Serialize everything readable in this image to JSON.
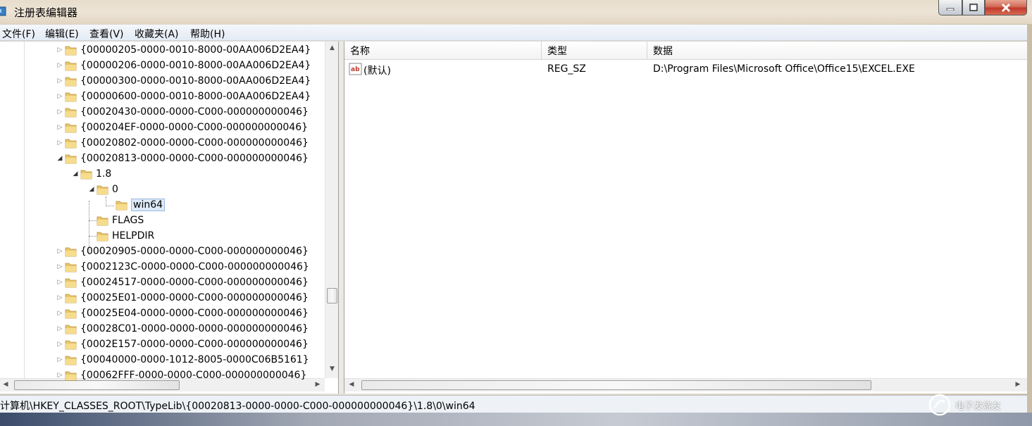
{
  "window": {
    "title": "注册表编辑器",
    "buttons": {
      "minimize": "minimize-icon",
      "maximize": "maximize-icon",
      "close": "close-icon"
    }
  },
  "menu": [
    "文件(F)",
    "编辑(E)",
    "查看(V)",
    "收藏夹(A)",
    "帮助(H)"
  ],
  "tree": {
    "nodes": [
      {
        "label": "{00000205-0000-0010-8000-00AA006D2EA4}",
        "expanded": false
      },
      {
        "label": "{00000206-0000-0010-8000-00AA006D2EA4}",
        "expanded": false
      },
      {
        "label": "{00000300-0000-0010-8000-00AA006D2EA4}",
        "expanded": false
      },
      {
        "label": "{00000600-0000-0010-8000-00AA006D2EA4}",
        "expanded": false
      },
      {
        "label": "{00020430-0000-0000-C000-000000000046}",
        "expanded": false
      },
      {
        "label": "{000204EF-0000-0000-C000-000000000046}",
        "expanded": false
      },
      {
        "label": "{00020802-0000-0000-C000-000000000046}",
        "expanded": false
      },
      {
        "label": "{00020813-0000-0000-C000-000000000046}",
        "expanded": true
      },
      {
        "label": "1.8",
        "expanded": true
      },
      {
        "label": "0",
        "expanded": true
      },
      {
        "label": "win64",
        "selected": true
      },
      {
        "label": "FLAGS"
      },
      {
        "label": "HELPDIR"
      },
      {
        "label": "{00020905-0000-0000-C000-000000000046}",
        "expanded": false
      },
      {
        "label": "{0002123C-0000-0000-C000-000000000046}",
        "expanded": false
      },
      {
        "label": "{00024517-0000-0000-C000-000000000046}",
        "expanded": false
      },
      {
        "label": "{00025E01-0000-0000-C000-000000000046}",
        "expanded": false
      },
      {
        "label": "{00025E04-0000-0000-C000-000000000046}",
        "expanded": false
      },
      {
        "label": "{00028C01-0000-0000-0000-000000000046}",
        "expanded": false
      },
      {
        "label": "{0002E157-0000-0000-C000-000000000046}",
        "expanded": false
      },
      {
        "label": "{00040000-0000-1012-8005-0000C06B5161}",
        "expanded": false
      },
      {
        "label": "{00062FFF-0000-0000-C000-000000000046}",
        "expanded": false
      }
    ]
  },
  "list": {
    "columns": [
      "名称",
      "类型",
      "数据"
    ],
    "rows": [
      {
        "name": "(默认)",
        "type": "REG_SZ",
        "data": "D:\\Program Files\\Microsoft Office\\Office15\\EXCEL.EXE",
        "icon": "string-value-icon"
      }
    ]
  },
  "status": {
    "path": "计算机\\HKEY_CLASSES_ROOT\\TypeLib\\{00020813-0000-0000-C000-000000000046}\\1.8\\0\\win64"
  },
  "watermark": {
    "text": "电子发烧友"
  }
}
